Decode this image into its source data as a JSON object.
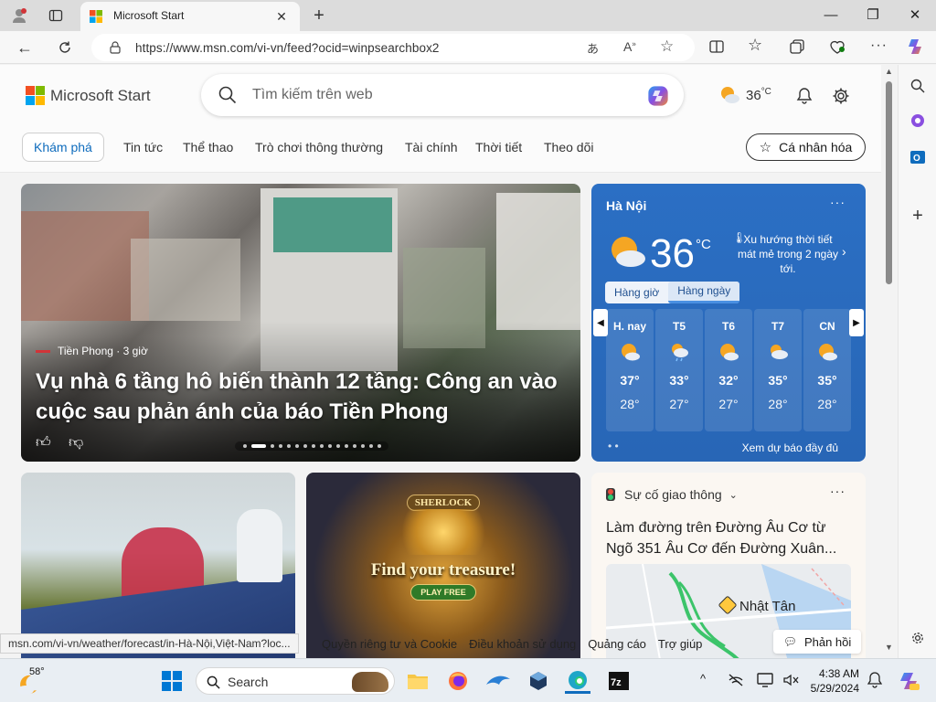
{
  "browser": {
    "tab_title": "Microsoft Start",
    "url": "https://www.msn.com/vi-vn/feed?ocid=winpsearchbox2"
  },
  "header": {
    "brand": "Microsoft Start",
    "search_placeholder": "Tìm kiếm trên web",
    "weather_temp": "36",
    "weather_unit": "°C"
  },
  "nav": {
    "items": [
      "Khám phá",
      "Tin tức",
      "Thể thao",
      "Trò chơi thông thường",
      "Tài chính",
      "Thời tiết",
      "Theo dõi"
    ],
    "personalize": "Cá nhân hóa"
  },
  "hero": {
    "source": "Tiền Phong · 3 giờ",
    "title": "Vụ nhà 6 tầng hô biến thành 12 tầng: Công an vào cuộc sau phản ánh của báo Tiền Phong"
  },
  "weather": {
    "city": "Hà Nội",
    "temp": "36",
    "unit": "°C",
    "trend": "Xu hướng thời tiết mát mẻ trong 2 ngày tới.",
    "tab_hourly": "Hàng giờ",
    "tab_daily": "Hàng ngày",
    "days": [
      {
        "name": "H. nay",
        "hi": "37°",
        "lo": "28°"
      },
      {
        "name": "T5",
        "hi": "33°",
        "lo": "27°"
      },
      {
        "name": "T6",
        "hi": "32°",
        "lo": "27°"
      },
      {
        "name": "T7",
        "hi": "35°",
        "lo": "28°"
      },
      {
        "name": "CN",
        "hi": "35°",
        "lo": "28°"
      }
    ],
    "full_forecast": "Xem dự báo đầy đủ"
  },
  "ad": {
    "logo": "SHERLOCK",
    "title": "Find your treasure!",
    "button": "PLAY FREE"
  },
  "traffic": {
    "category": "Sự cố giao thông",
    "title": "Làm đường trên Đường Âu Cơ từ Ngõ 351 Âu Cơ đến Đường Xuân...",
    "map_label": "Nhật Tân"
  },
  "status_url": "msn.com/vi-vn/weather/forecast/in-Hà-Nội,Việt-Nam?loc...",
  "footer": {
    "links": [
      "Quyền riêng tư và Cookie",
      "Điều khoản sử dụng",
      "Quảng cáo",
      "Trợ giúp"
    ],
    "feedback": "Phản hồi"
  },
  "taskbar": {
    "weather_temp": "58°",
    "search": "Search",
    "time": "4:38 AM",
    "date": "5/29/2024"
  },
  "colors": {
    "accent": "#0f6cbd",
    "weather_card": "#2b6fc4"
  }
}
